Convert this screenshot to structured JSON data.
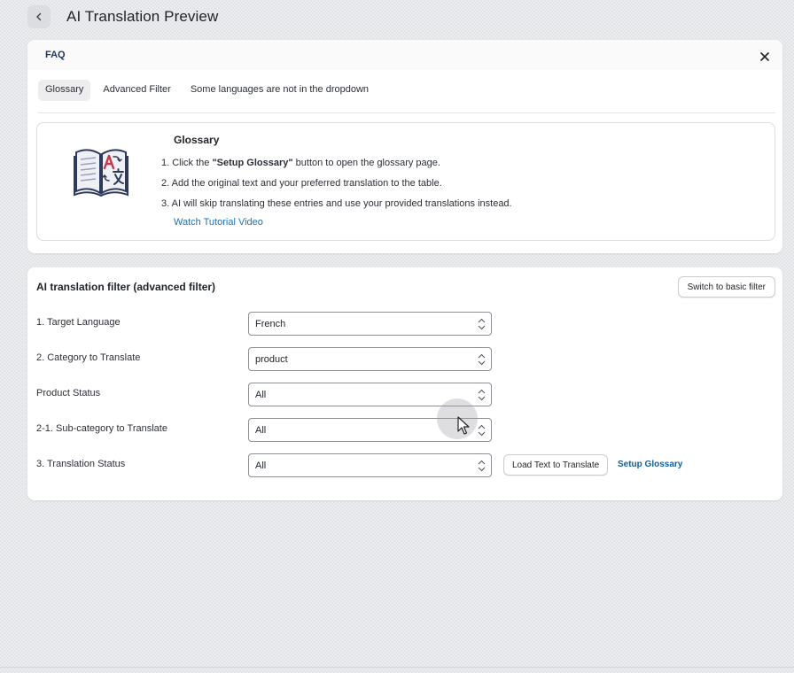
{
  "header": {
    "title": "AI Translation Preview"
  },
  "faq": {
    "title": "FAQ",
    "tabs": [
      {
        "label": "Glossary",
        "active": true
      },
      {
        "label": "Advanced Filter",
        "active": false
      },
      {
        "label": "Some languages are not in the dropdown",
        "active": false
      }
    ],
    "glossary": {
      "title": "Glossary",
      "step1_prefix": "1. Click the ",
      "step1_bold": "\"Setup Glossary\"",
      "step1_suffix": " button to open the glossary page.",
      "step2": "2. Add the original text and your preferred translation to the table.",
      "step3": "3. AI will skip translating these entries and use your provided translations instead.",
      "link": "Watch Tutorial Video"
    }
  },
  "filter": {
    "title": "AI translation filter (advanced filter)",
    "switch_button": "Switch to basic filter",
    "rows": [
      {
        "label": "1. Target Language",
        "value": "French"
      },
      {
        "label": "2. Category to Translate",
        "value": "product"
      },
      {
        "label": "Product Status",
        "value": "All"
      },
      {
        "label": "2-1. Sub-category to Translate",
        "value": "All"
      },
      {
        "label": "3. Translation Status",
        "value": "All"
      }
    ],
    "load_button": "Load Text to Translate",
    "setup_link": "Setup Glossary"
  },
  "colors": {
    "link": "#2271b1",
    "faq_title": "#1d3557",
    "setup_link": "#135e96"
  },
  "icons": [
    "chevron-left-icon",
    "close-icon",
    "glossary-book-icon",
    "select-chevron-icon",
    "cursor-pointer-icon"
  ]
}
